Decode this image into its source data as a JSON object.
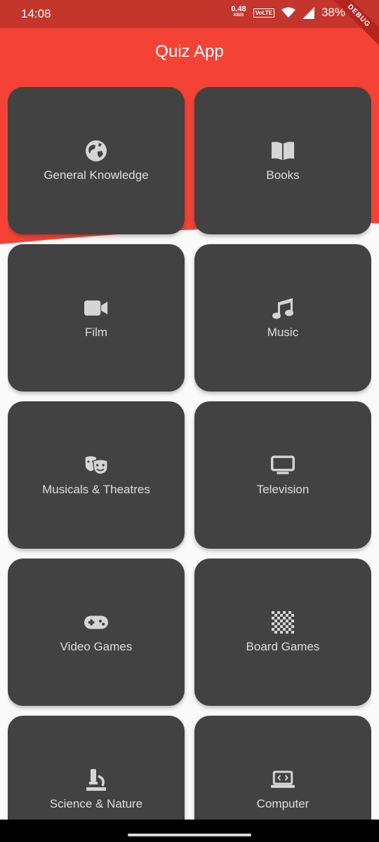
{
  "status": {
    "time": "14:08",
    "net_speed_value": "0.48",
    "net_speed_unit": "KB/S",
    "volte": "VoLTE",
    "battery": "38%"
  },
  "debug_banner": "DEBUG",
  "app": {
    "title": "Quiz App"
  },
  "colors": {
    "header_red": "#f44336",
    "status_red": "#c4352c",
    "card": "#424242",
    "background": "#fafafa"
  },
  "categories": [
    {
      "label": "General Knowledge",
      "icon": "globe-icon"
    },
    {
      "label": "Books",
      "icon": "book-icon"
    },
    {
      "label": "Film",
      "icon": "video-camera-icon"
    },
    {
      "label": "Music",
      "icon": "music-note-icon"
    },
    {
      "label": "Musicals & Theatres",
      "icon": "theater-masks-icon"
    },
    {
      "label": "Television",
      "icon": "tv-icon"
    },
    {
      "label": "Video Games",
      "icon": "gamepad-icon"
    },
    {
      "label": "Board Games",
      "icon": "chessboard-icon"
    },
    {
      "label": "Science & Nature",
      "icon": "microscope-icon"
    },
    {
      "label": "Computer",
      "icon": "laptop-code-icon"
    }
  ]
}
